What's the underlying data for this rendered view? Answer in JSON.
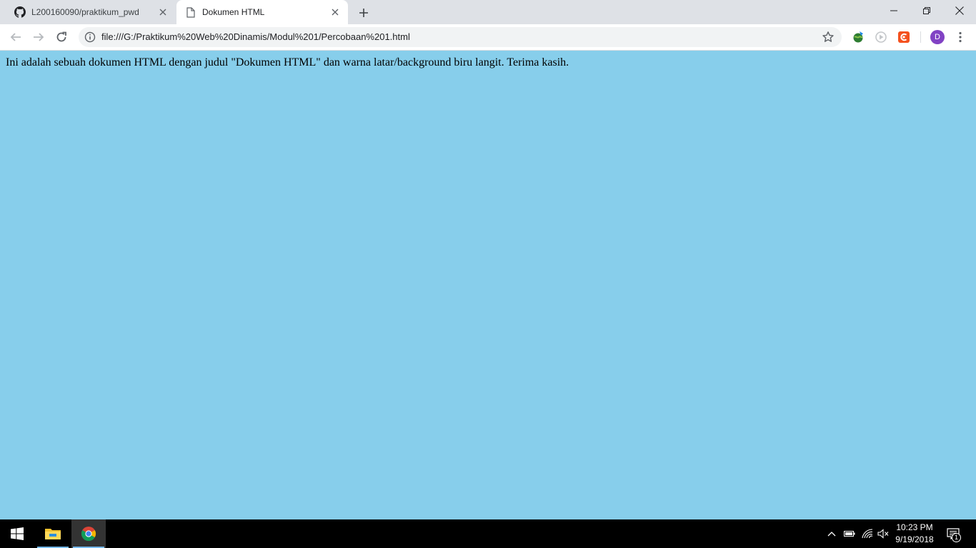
{
  "browser": {
    "tabs": [
      {
        "title": "L200160090/praktikum_pwd",
        "icon": "github-icon",
        "active": false
      },
      {
        "title": "Dokumen HTML",
        "icon": "document-icon",
        "active": true
      }
    ],
    "address_bar": {
      "url": "file:///G:/Praktikum%20Web%20Dinamis/Modul%201/Percobaan%201.html"
    },
    "profile_initial": "D"
  },
  "page": {
    "background_color": "#87ceeb",
    "text": "Ini adalah sebuah dokumen HTML dengan judul \"Dokumen HTML\" dan warna latar/background biru langit. Terima kasih."
  },
  "taskbar": {
    "time": "10:23 PM",
    "date": "9/19/2018",
    "notification_count": "1"
  }
}
